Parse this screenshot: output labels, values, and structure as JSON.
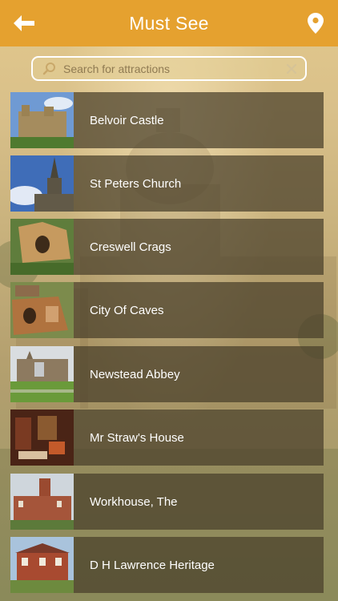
{
  "header": {
    "title": "Must See",
    "back_icon": "arrow-left-icon",
    "location_icon": "map-pin-icon",
    "bar_color": "#e5a12f"
  },
  "search": {
    "placeholder": "Search for attractions",
    "value": "",
    "icon": "search-icon",
    "clear_icon": "clear-icon"
  },
  "attractions": [
    {
      "name": "Belvoir Castle"
    },
    {
      "name": "St Peters Church"
    },
    {
      "name": "Creswell Crags"
    },
    {
      "name": "City Of Caves"
    },
    {
      "name": "Newstead Abbey"
    },
    {
      "name": "Mr Straw's House"
    },
    {
      "name": "Workhouse, The"
    },
    {
      "name": "D H Lawrence Heritage"
    }
  ]
}
